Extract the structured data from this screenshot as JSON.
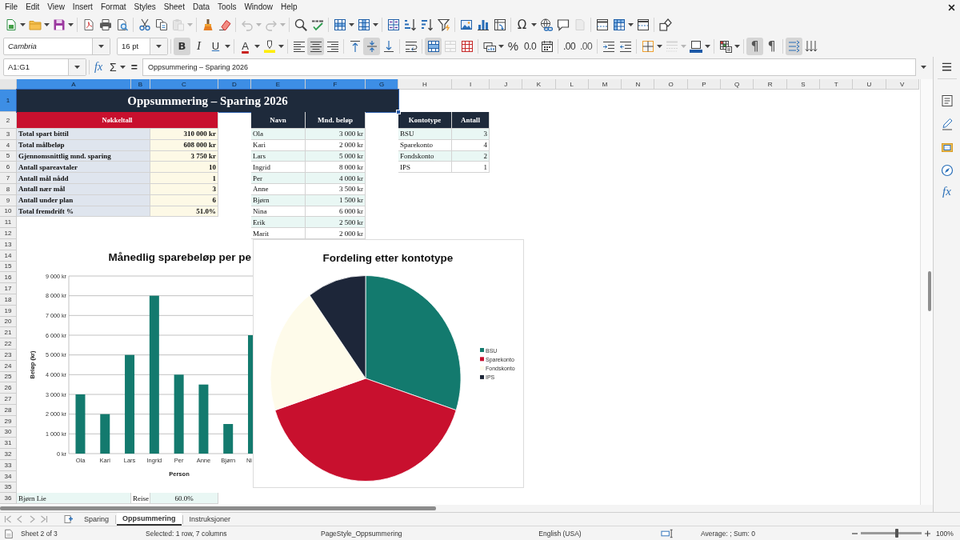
{
  "menu_bar": {
    "items": [
      "File",
      "Edit",
      "View",
      "Insert",
      "Format",
      "Styles",
      "Sheet",
      "Data",
      "Tools",
      "Window",
      "Help"
    ]
  },
  "standard_toolbar": {
    "items": [
      {
        "disabled": false
      },
      {
        "disabled": false
      },
      {
        "disabled": false
      },
      {
        "disabled": false
      },
      {
        "disabled": false
      },
      {
        "disabled": false
      },
      {
        "disabled": false
      },
      {
        "disabled": false
      },
      {
        "disabled": true
      },
      {
        "disabled": false
      },
      {
        "disabled": false
      },
      {
        "disabled": true
      },
      {
        "disabled": true
      },
      {
        "disabled": false
      },
      {
        "disabled": false
      },
      {
        "disabled": false
      },
      {
        "disabled": false
      },
      {
        "disabled": false
      },
      {
        "disabled": false
      },
      {
        "disabled": false
      },
      {
        "disabled": false
      },
      {
        "disabled": false
      },
      {
        "disabled": false
      },
      {
        "disabled": false
      },
      {
        "disabled": false,
        "glyph": "Ω"
      },
      {
        "disabled": false
      },
      {
        "disabled": false
      },
      {
        "disabled": true
      },
      {
        "disabled": false
      },
      {
        "disabled": false
      },
      {
        "disabled": false
      },
      {
        "disabled": false
      }
    ]
  },
  "formatting_toolbar": {
    "font_name": "Cambria",
    "font_size": "16 pt",
    "items": [
      {
        "pressed": true,
        "disabled": false,
        "glyph": "B"
      },
      {
        "pressed": false,
        "disabled": false,
        "glyph": "I"
      },
      {
        "pressed": false,
        "disabled": false,
        "glyph": "U"
      },
      {
        "pressed": false,
        "disabled": false,
        "glyph": "A"
      },
      {
        "pressed": false,
        "disabled": false
      },
      {
        "pressed": false,
        "disabled": false
      },
      {
        "pressed": true,
        "disabled": false
      },
      {
        "pressed": false,
        "disabled": false
      },
      {
        "pressed": false,
        "disabled": false
      },
      {
        "pressed": true,
        "disabled": false
      },
      {
        "pressed": false,
        "disabled": false
      },
      {
        "pressed": false,
        "disabled": false
      },
      {
        "pressed": true,
        "disabled": false
      },
      {
        "pressed": false,
        "disabled": true
      },
      {
        "pressed": false,
        "disabled": false
      },
      {
        "pressed": false,
        "disabled": false
      },
      {
        "pressed": false,
        "disabled": false,
        "glyph": "%"
      },
      {
        "pressed": false,
        "disabled": false,
        "glyph": "0.0"
      },
      {
        "pressed": false,
        "disabled": false
      },
      {
        "pressed": false,
        "disabled": false,
        "glyph": ".00"
      },
      {
        "pressed": false,
        "disabled": false,
        "glyph": ".00"
      },
      {
        "pressed": false,
        "disabled": false
      },
      {
        "pressed": false,
        "disabled": false
      },
      {
        "pressed": false,
        "disabled": false
      },
      {
        "pressed": false,
        "disabled": true
      },
      {
        "pressed": false,
        "disabled": false
      },
      {
        "pressed": false,
        "disabled": false
      },
      {
        "pressed": true,
        "disabled": false,
        "glyph": "¶"
      },
      {
        "pressed": false,
        "disabled": false,
        "glyph": "¶"
      },
      {
        "pressed": true,
        "disabled": false
      },
      {
        "pressed": false,
        "disabled": false
      }
    ]
  },
  "formula_bar": {
    "name_box": "A1:G1",
    "function_wizard": "fx",
    "sum": "Σ",
    "equals": "=",
    "content": "Oppsummering – Sparing 2026"
  },
  "sidebar": {
    "functions": "fx"
  },
  "columns": [
    {
      "label": "A",
      "selected": true
    },
    {
      "label": "B",
      "selected": true
    },
    {
      "label": "C",
      "selected": true
    },
    {
      "label": "D",
      "selected": true
    },
    {
      "label": "E",
      "selected": true
    },
    {
      "label": "F",
      "selected": true
    },
    {
      "label": "G",
      "selected": true
    },
    {
      "label": "H",
      "selected": false
    },
    {
      "label": "I",
      "selected": false
    },
    {
      "label": "J",
      "selected": false
    },
    {
      "label": "K",
      "selected": false
    },
    {
      "label": "L",
      "selected": false
    },
    {
      "label": "M",
      "selected": false
    },
    {
      "label": "N",
      "selected": false
    },
    {
      "label": "O",
      "selected": false
    },
    {
      "label": "P",
      "selected": false
    },
    {
      "label": "Q",
      "selected": false
    },
    {
      "label": "R",
      "selected": false
    },
    {
      "label": "S",
      "selected": false
    },
    {
      "label": "T",
      "selected": false
    },
    {
      "label": "U",
      "selected": false
    },
    {
      "label": "V",
      "selected": false
    }
  ],
  "rows": [
    {
      "label": "1",
      "selected": true
    },
    {
      "label": "2",
      "selected": false
    },
    {
      "label": "3",
      "selected": false
    },
    {
      "label": "4",
      "selected": false
    },
    {
      "label": "5",
      "selected": false
    },
    {
      "label": "6",
      "selected": false
    },
    {
      "label": "7",
      "selected": false
    },
    {
      "label": "8",
      "selected": false
    },
    {
      "label": "9",
      "selected": false
    },
    {
      "label": "10",
      "selected": false
    },
    {
      "label": "11",
      "selected": false
    },
    {
      "label": "12",
      "selected": false
    },
    {
      "label": "13",
      "selected": false
    },
    {
      "label": "14",
      "selected": false
    },
    {
      "label": "15",
      "selected": false
    },
    {
      "label": "16",
      "selected": false
    },
    {
      "label": "17",
      "selected": false
    },
    {
      "label": "18",
      "selected": false
    },
    {
      "label": "19",
      "selected": false
    },
    {
      "label": "20",
      "selected": false
    },
    {
      "label": "21",
      "selected": false
    },
    {
      "label": "22",
      "selected": false
    },
    {
      "label": "23",
      "selected": false
    },
    {
      "label": "24",
      "selected": false
    },
    {
      "label": "25",
      "selected": false
    },
    {
      "label": "26",
      "selected": false
    },
    {
      "label": "27",
      "selected": false
    },
    {
      "label": "28",
      "selected": false
    },
    {
      "label": "29",
      "selected": false
    },
    {
      "label": "30",
      "selected": false
    },
    {
      "label": "31",
      "selected": false
    },
    {
      "label": "32",
      "selected": false
    },
    {
      "label": "33",
      "selected": false
    },
    {
      "label": "34",
      "selected": false
    },
    {
      "label": "35",
      "selected": false
    },
    {
      "label": "36",
      "selected": false
    }
  ],
  "title_banner": {
    "text": "Oppsummering – Sparing 2026",
    "selected": true
  },
  "key_figures": {
    "header": "Nøkkeltall",
    "rows": [
      {
        "label": "Total spart bittil",
        "value": "310 000 kr"
      },
      {
        "label": "Total målbeløp",
        "value": "608 000 kr"
      },
      {
        "label": "Gjennomsnittlig mnd. sparing",
        "value": "3 750 kr"
      },
      {
        "label": "Antall spareavtaler",
        "value": "10"
      },
      {
        "label": "Antall mål nådd",
        "value": "1"
      },
      {
        "label": "Antall nær mål",
        "value": "3"
      },
      {
        "label": "Antall under plan",
        "value": "6"
      },
      {
        "label": "Total fremdrift %",
        "value": "51.0%"
      }
    ]
  },
  "savers_table": {
    "columns": [
      "Navn",
      "Mnd. beløp"
    ],
    "rows": [
      [
        "Ola",
        "3 000 kr"
      ],
      [
        "Kari",
        "2 000 kr"
      ],
      [
        "Lars",
        "5 000 kr"
      ],
      [
        "Ingrid",
        "8 000 kr"
      ],
      [
        "Per",
        "4 000 kr"
      ],
      [
        "Anne",
        "3 500 kr"
      ],
      [
        "Bjørn",
        "1 500 kr"
      ],
      [
        "Nina",
        "6 000 kr"
      ],
      [
        "Erik",
        "2 500 kr"
      ],
      [
        "Marit",
        "2 000 kr"
      ]
    ]
  },
  "account_types_table": {
    "columns": [
      "Kontotype",
      "Antall"
    ],
    "rows": [
      [
        "BSU",
        "3"
      ],
      [
        "Sparekonto",
        "4"
      ],
      [
        "Fondskonto",
        "2"
      ],
      [
        "IPS",
        "1"
      ]
    ]
  },
  "lower_row": {
    "cells": [
      "Bjørn Lie",
      "Reise",
      "60.0%"
    ]
  },
  "bar_chart": {
    "chart_data": {
      "type": "bar",
      "title": "Månedlig sparebeløp per pe",
      "xlabel": "Person",
      "ylabel": "Beløp (kr)",
      "categories": [
        "Ola",
        "Kari",
        "Lars",
        "Ingrid",
        "Per",
        "Anne",
        "Bjørn",
        "Ni"
      ],
      "series": [
        {
          "color": "#137a6e",
          "values": [
            3000,
            2000,
            5000,
            8000,
            4000,
            3500,
            1500,
            6000
          ]
        }
      ],
      "ylim": [
        0,
        9000
      ],
      "yticks": [
        {
          "value": 0,
          "label": "0 kr"
        },
        {
          "value": 1000,
          "label": "1 000 kr"
        },
        {
          "value": 2000,
          "label": "2 000 kr"
        },
        {
          "value": 3000,
          "label": "3 000 kr"
        },
        {
          "value": 4000,
          "label": "4 000 kr"
        },
        {
          "value": 5000,
          "label": "5 000 kr"
        },
        {
          "value": 6000,
          "label": "6 000 kr"
        },
        {
          "value": 7000,
          "label": "7 000 kr"
        },
        {
          "value": 8000,
          "label": "8 000 kr"
        },
        {
          "value": 9000,
          "label": "9 000 kr"
        }
      ],
      "grid": true
    }
  },
  "pie_chart": {
    "chart_data": {
      "type": "pie",
      "title": "Fordeling etter kontotype",
      "categories": [
        "BSU",
        "Sparekonto",
        "Fondskonto",
        "IPS"
      ],
      "values": [
        30,
        40,
        20,
        10
      ],
      "colors": [
        "#137a6e",
        "#c8102e",
        "#fefbea",
        "#1d2639"
      ],
      "legend": true
    }
  },
  "sheet_tabs": [
    {
      "label": "Sparing",
      "selected": false
    },
    {
      "label": "Oppsummering",
      "selected": true
    },
    {
      "label": "Instruksjoner",
      "selected": false
    }
  ],
  "status_bar": {
    "sheet": "Sheet 2 of 3",
    "selection": "Selected: 1 row, 7 columns",
    "page_style": "PageStyle_Oppsummering",
    "language": "English (USA)",
    "summary": "Average: ; Sum: 0",
    "zoom": {
      "level": 0.59,
      "reading": "100%"
    }
  }
}
